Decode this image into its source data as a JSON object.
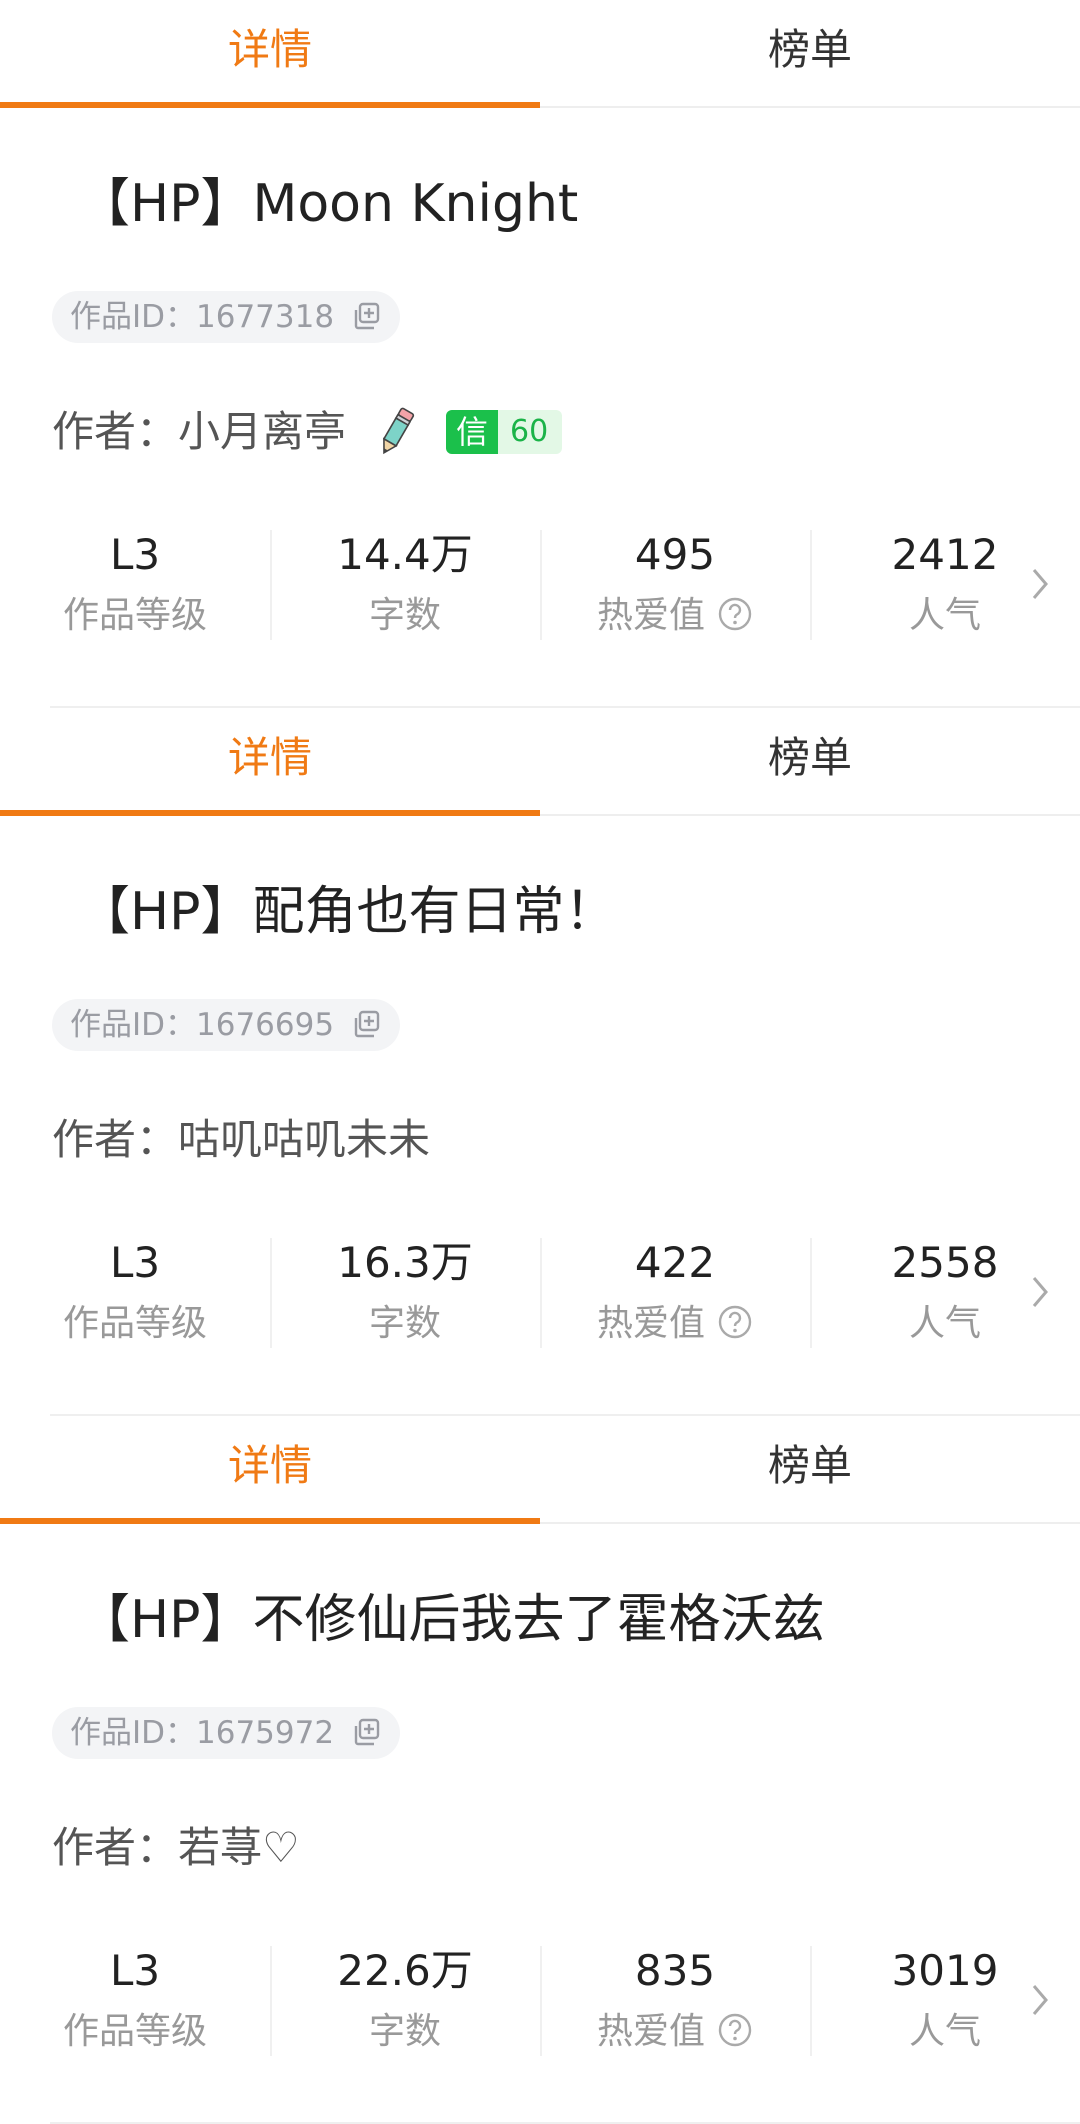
{
  "tabs": {
    "detail": "详情",
    "ranking": "榜单"
  },
  "labels": {
    "work_id_prefix": "作品ID：",
    "author_prefix": "作者：",
    "stat_level": "作品等级",
    "stat_words": "字数",
    "stat_love": "热爱值",
    "stat_popularity": "人气"
  },
  "works": [
    {
      "title": "【HP】Moon Knight",
      "work_id": "1677318",
      "author": "小月离亭",
      "has_pencil_icon": true,
      "trust_badge": {
        "icon": "信",
        "score": "60"
      },
      "level": "L3",
      "words": "14.4万",
      "love": "495",
      "popularity": "2412"
    },
    {
      "title": "【HP】配角也有日常！",
      "work_id": "1676695",
      "author": "咕叽咕叽未未",
      "has_pencil_icon": false,
      "level": "L3",
      "words": "16.3万",
      "love": "422",
      "popularity": "2558"
    },
    {
      "title": "【HP】不修仙后我去了霍格沃兹",
      "work_id": "1675972",
      "author": "若荨♡",
      "has_pencil_icon": false,
      "level": "L3",
      "words": "22.6万",
      "love": "835",
      "popularity": "3019"
    }
  ],
  "colors": {
    "accent": "#f07a14",
    "trust_green": "#1bc04b"
  }
}
